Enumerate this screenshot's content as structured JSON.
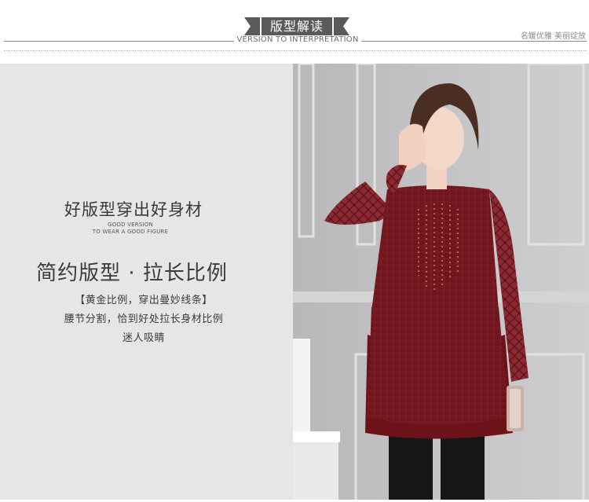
{
  "header": {
    "title": "版型解读",
    "subtitle": "VERSION TO INTERPRETATION",
    "tagline": "名媛优雅 美丽绽放"
  },
  "left_panel": {
    "headline": "好版型穿出好身材",
    "english_line_1": "GOOD VERSION",
    "english_line_2": "TO WEAR A GOOD FIGURE",
    "sub_headline": "简约版型 · 拉长比例",
    "body_lines": [
      "【黄金比例，穿出曼妙线条】",
      "腰节分割，恰到好处拉长身材比例",
      "迷人吸睛"
    ]
  },
  "colors": {
    "banner": "#5a5a5c",
    "panel_bg": "#e6e6e8",
    "wall": "#c2c2c4",
    "garment": "#7a1a22",
    "garment_dark": "#5a0f16"
  },
  "photo": {
    "subject": "model-photo",
    "garment_icon": "burgundy-lace-top-icon",
    "bag_icon": "clutch-bag-icon"
  }
}
